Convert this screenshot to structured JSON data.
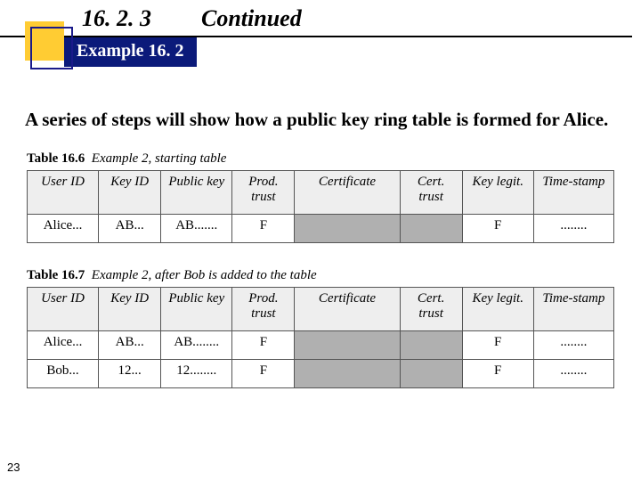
{
  "header": {
    "section": "16. 2. 3",
    "continued": "Continued",
    "example_label": "Example 16. 2"
  },
  "body": "A series of steps will show how a public key ring table is formed for Alice.",
  "tables": {
    "t1": {
      "caption_num": "Table 16.6",
      "caption_txt": "Example 2, starting table",
      "headers": [
        "User ID",
        "Key ID",
        "Public key",
        "Prod. trust",
        "Certificate",
        "Cert. trust",
        "Key legit.",
        "Time-stamp"
      ],
      "rows": [
        {
          "c1": "Alice...",
          "c2": "AB...",
          "c3": "AB.......",
          "c4": "F",
          "c5": "",
          "c6": "",
          "c7": "F",
          "c8": "........"
        }
      ]
    },
    "t2": {
      "caption_num": "Table 16.7",
      "caption_txt": "Example 2, after Bob is added to the table",
      "headers": [
        "User ID",
        "Key ID",
        "Public key",
        "Prod. trust",
        "Certificate",
        "Cert. trust",
        "Key legit.",
        "Time-stamp"
      ],
      "rows": [
        {
          "c1": "Alice...",
          "c2": "AB...",
          "c3": "AB........",
          "c4": "F",
          "c5": "",
          "c6": "",
          "c7": "F",
          "c8": "........"
        },
        {
          "c1": "Bob...",
          "c2": "12...",
          "c3": "12........",
          "c4": "F",
          "c5": "",
          "c6": "",
          "c7": "F",
          "c8": "........"
        }
      ]
    }
  },
  "page_number": "23"
}
